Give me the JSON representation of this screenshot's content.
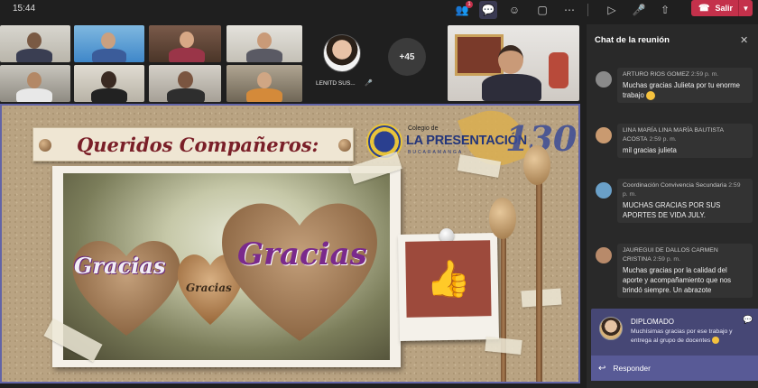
{
  "topbar": {
    "clock": "15:44",
    "people_badge": "1",
    "leave_label": "Salir"
  },
  "participants": {
    "avatar_name": "LENITD SUS...",
    "more_count": "+45"
  },
  "slide": {
    "banner_title": "Queridos Compañeros:",
    "school_small": "Colegio de",
    "school_name": "LA PRESENTACIÓN",
    "school_sub": "BUCARAMANGA",
    "anniversary": "130",
    "word_big": "Gracias",
    "word_left": "Gracias",
    "word_mid": "Gracias"
  },
  "chat": {
    "title": "Chat de la reunión",
    "messages": [
      {
        "name": "ARTURO RIOS GOMEZ",
        "time": "2:59 p. m.",
        "text": "Muchas gracias Julieta por tu enorme trabajo",
        "avatar_color": "#8a8a8a"
      },
      {
        "name": "LINA MARÍA LINA MARÍA BAUTISTA ACOSTA",
        "time": "2:59 p. m.",
        "text": "mil gracias julieta",
        "avatar_color": "#c99a70"
      },
      {
        "name": "Coordinación Convivencia Secundaria",
        "time": "2:59 p. m.",
        "text": "MUCHAS GRACIAS POR SUS APORTES DE VIDA JULY.",
        "avatar_color": "#6aa0c8"
      },
      {
        "name": "JAUREGUI DE DALLOS CARMEN CRISTINA",
        "time": "2:59 p. m.",
        "text": "Muchas gracias por la calidad del aporte y acompañamiento que nos brindó siempre. Un abrazote",
        "avatar_color": "#b88a6a"
      }
    ]
  },
  "notification": {
    "sender": "DIPLOMADO",
    "text": "Muchísimas gracias por ese trabajo y entrega al grupo de docentes",
    "reply_label": "Responder"
  }
}
